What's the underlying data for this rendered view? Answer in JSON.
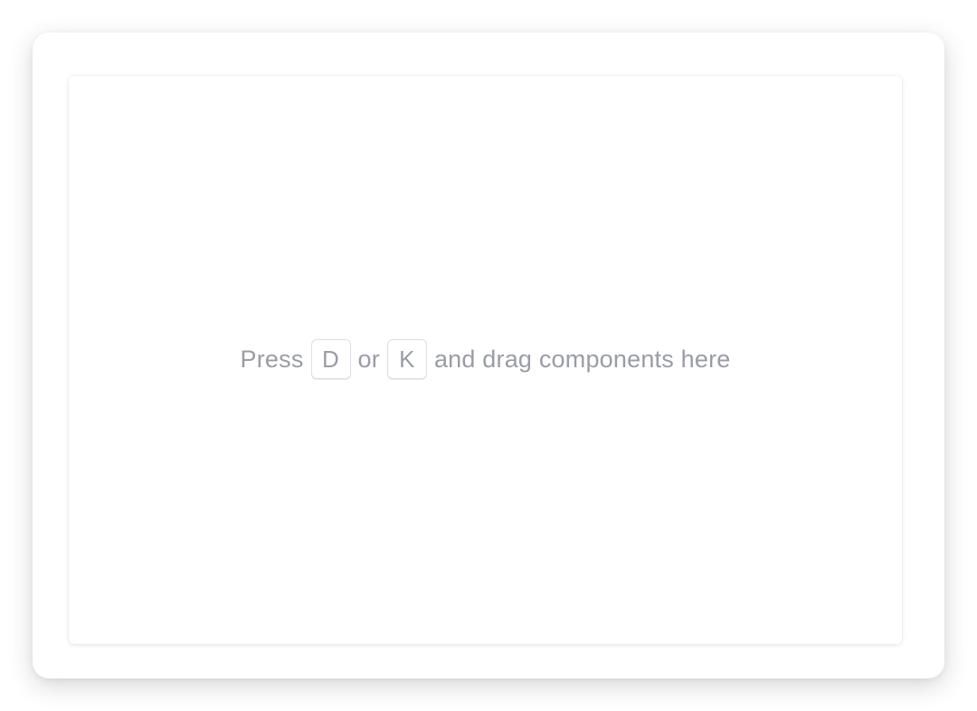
{
  "canvas": {
    "hint": {
      "prefix": "Press",
      "key_one": "D",
      "joiner": "or",
      "key_two": "K",
      "suffix": "and drag components here"
    }
  },
  "colors": {
    "background": "#ffffff",
    "hint_text": "#9a9ca6",
    "key_border": "#dedfe4"
  }
}
